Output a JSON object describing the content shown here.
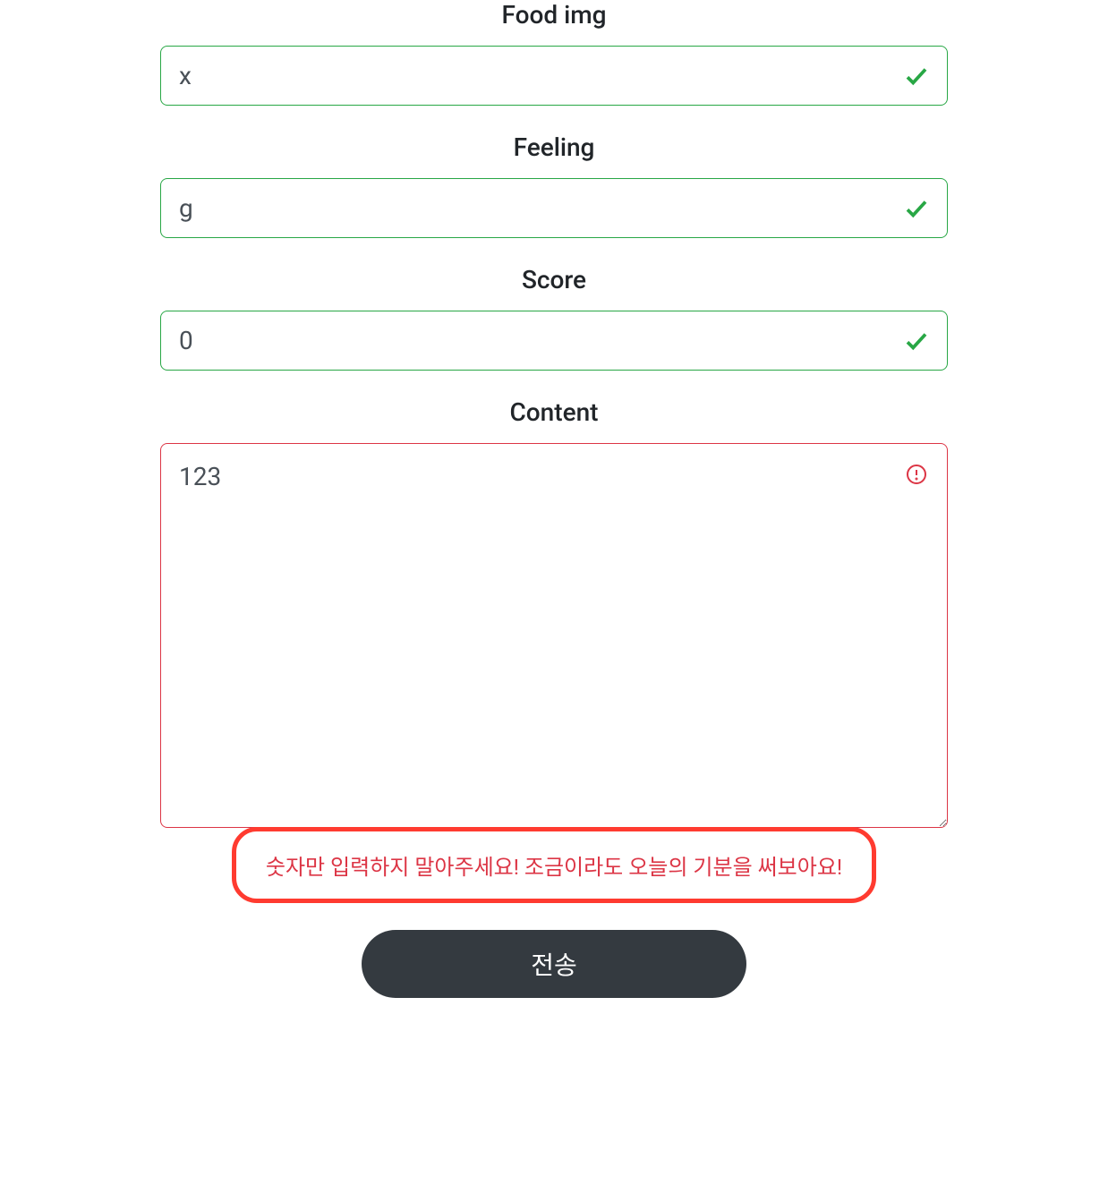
{
  "fields": {
    "food_img": {
      "label": "Food img",
      "value": "x",
      "valid": true
    },
    "feeling": {
      "label": "Feeling",
      "value": "g",
      "valid": true
    },
    "score": {
      "label": "Score",
      "value": "0",
      "valid": true
    },
    "content": {
      "label": "Content",
      "value": "123",
      "valid": false,
      "error_message": "숫자만 입력하지 말아주세요! 조금이라도 오늘의 기분을 써보아요!"
    }
  },
  "submit_label": "전송",
  "colors": {
    "valid_border": "#28a745",
    "invalid_border": "#dc3545",
    "highlight_border": "#ff3b30",
    "button_bg": "#343a40"
  }
}
